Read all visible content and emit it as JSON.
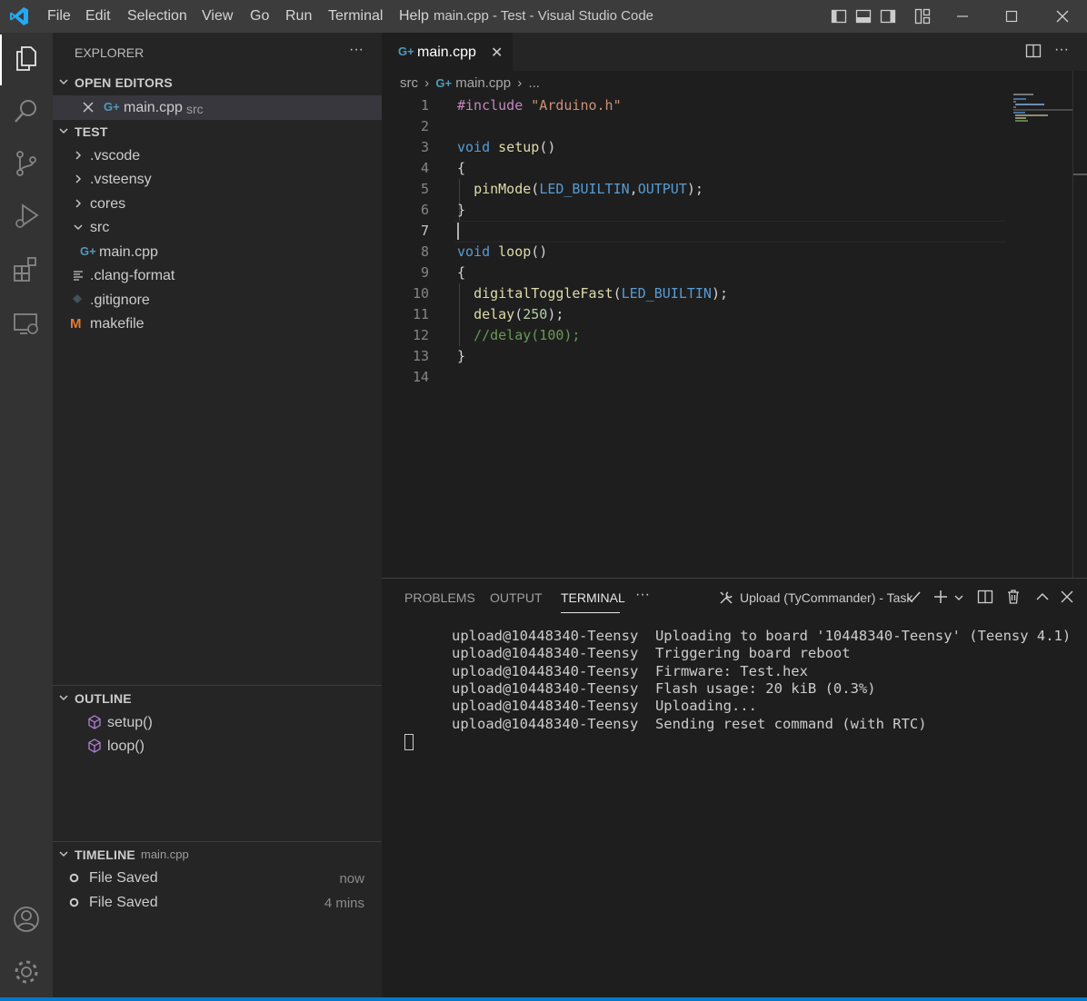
{
  "window": {
    "title": "main.cpp - Test - Visual Studio Code",
    "menu": [
      "File",
      "Edit",
      "Selection",
      "View",
      "Go",
      "Run",
      "Terminal",
      "Help"
    ]
  },
  "colors": {
    "accent": "#007acc",
    "keyword": "#569cd6",
    "function": "#dcdcaa",
    "string": "#ce9178",
    "comment": "#6a9955",
    "number": "#b5cea8",
    "preprocessor": "#c586c0",
    "macro": "#569cd6",
    "cpp_icon": "#519aba",
    "makefile_icon": "#e37933",
    "outline_icon": "#b180d7"
  },
  "activity_bar": {
    "items": [
      "explorer-icon",
      "search-icon",
      "source-control-icon",
      "run-debug-icon",
      "extensions-icon",
      "remote-explorer-icon"
    ],
    "bottom": [
      "accounts-icon",
      "manage-gear-icon"
    ]
  },
  "sidebar": {
    "title": "EXPLORER",
    "more": "···",
    "open_editors": {
      "heading": "OPEN EDITORS",
      "items": [
        {
          "name": "main.cpp",
          "folder": "src"
        }
      ]
    },
    "workspace": {
      "heading": "TEST",
      "items": [
        {
          "name": ".vscode",
          "type": "folder"
        },
        {
          "name": ".vsteensy",
          "type": "folder"
        },
        {
          "name": "cores",
          "type": "folder"
        },
        {
          "name": "src",
          "type": "folder-open"
        },
        {
          "name": "main.cpp",
          "type": "cpp"
        },
        {
          "name": ".clang-format",
          "type": "text"
        },
        {
          "name": ".gitignore",
          "type": "git"
        },
        {
          "name": "makefile",
          "type": "makefile"
        }
      ]
    },
    "outline": {
      "heading": "OUTLINE",
      "items": [
        "setup()",
        "loop()"
      ]
    },
    "timeline": {
      "heading": "TIMELINE",
      "file": "main.cpp",
      "items": [
        {
          "label": "File Saved",
          "time": "now"
        },
        {
          "label": "File Saved",
          "time": "4 mins"
        }
      ]
    }
  },
  "editor": {
    "tab": {
      "label": "main.cpp",
      "close": "✕"
    },
    "breadcrumb": {
      "folder": "src",
      "file": "main.cpp",
      "more": "..."
    },
    "current_line": 7,
    "lines": [
      {
        "n": "1",
        "t": [
          {
            "c": "preprocessor",
            "s": "#include "
          },
          {
            "c": "string",
            "s": "\"Arduino.h\""
          }
        ]
      },
      {
        "n": "2",
        "t": []
      },
      {
        "n": "3",
        "t": [
          {
            "c": "keyword",
            "s": "void "
          },
          {
            "c": "function",
            "s": "setup"
          },
          {
            "c": "plain",
            "s": "()"
          }
        ]
      },
      {
        "n": "4",
        "t": [
          {
            "c": "plain",
            "s": "{"
          }
        ]
      },
      {
        "n": "5",
        "t": [
          {
            "c": "plain",
            "s": "  "
          },
          {
            "c": "function",
            "s": "pinMode"
          },
          {
            "c": "plain",
            "s": "("
          },
          {
            "c": "macro",
            "s": "LED_BUILTIN"
          },
          {
            "c": "plain",
            "s": ","
          },
          {
            "c": "macro",
            "s": "OUTPUT"
          },
          {
            "c": "plain",
            "s": ");"
          }
        ]
      },
      {
        "n": "6",
        "t": [
          {
            "c": "plain",
            "s": "}"
          }
        ]
      },
      {
        "n": "7",
        "t": []
      },
      {
        "n": "8",
        "t": [
          {
            "c": "keyword",
            "s": "void "
          },
          {
            "c": "function",
            "s": "loop"
          },
          {
            "c": "plain",
            "s": "()"
          }
        ]
      },
      {
        "n": "9",
        "t": [
          {
            "c": "plain",
            "s": "{"
          }
        ]
      },
      {
        "n": "10",
        "t": [
          {
            "c": "plain",
            "s": "  "
          },
          {
            "c": "function",
            "s": "digitalToggleFast"
          },
          {
            "c": "plain",
            "s": "("
          },
          {
            "c": "macro",
            "s": "LED_BUILTIN"
          },
          {
            "c": "plain",
            "s": ");"
          }
        ]
      },
      {
        "n": "11",
        "t": [
          {
            "c": "plain",
            "s": "  "
          },
          {
            "c": "function",
            "s": "delay"
          },
          {
            "c": "plain",
            "s": "("
          },
          {
            "c": "number",
            "s": "250"
          },
          {
            "c": "plain",
            "s": ");"
          }
        ]
      },
      {
        "n": "12",
        "t": [
          {
            "c": "plain",
            "s": "  "
          },
          {
            "c": "comment",
            "s": "//delay(100);"
          }
        ]
      },
      {
        "n": "13",
        "t": [
          {
            "c": "plain",
            "s": "}"
          }
        ]
      },
      {
        "n": "14",
        "t": []
      }
    ]
  },
  "panel": {
    "tabs": [
      "PROBLEMS",
      "OUTPUT",
      "TERMINAL"
    ],
    "more": "···",
    "task_label": "Upload (TyCommander) - Task",
    "terminal_lines": [
      "upload@10448340-Teensy  Uploading to board '10448340-Teensy' (Teensy 4.1)",
      "upload@10448340-Teensy  Triggering board reboot",
      "upload@10448340-Teensy  Firmware: Test.hex",
      "upload@10448340-Teensy  Flash usage: 20 kiB (0.3%)",
      "upload@10448340-Teensy  Uploading...",
      "upload@10448340-Teensy  Sending reset command (with RTC)"
    ]
  }
}
